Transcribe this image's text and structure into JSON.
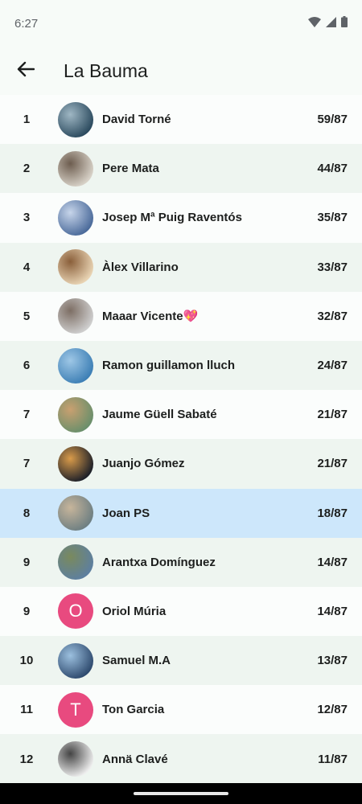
{
  "status": {
    "time": "6:27"
  },
  "header": {
    "title": "La Bauma"
  },
  "icons": {
    "back": "arrow-back-icon",
    "wifi": "wifi-icon",
    "signal": "signal-icon",
    "battery": "battery-icon"
  },
  "colors": {
    "highlight": "#cde7fb",
    "letter_avatar": "#e84a7f"
  },
  "rows": [
    {
      "rank": "1",
      "name": "David Torné",
      "score": "59/87",
      "avatar": "photo-avatar"
    },
    {
      "rank": "2",
      "name": "Pere Mata",
      "score": "44/87",
      "avatar": "photo-avatar"
    },
    {
      "rank": "3",
      "name": "Josep Mª Puig Raventós",
      "score": "35/87",
      "avatar": "photo-avatar"
    },
    {
      "rank": "4",
      "name": "Àlex Villarino",
      "score": "33/87",
      "avatar": "photo-avatar"
    },
    {
      "rank": "5",
      "name": "Maaar Vicente💖",
      "score": "32/87",
      "avatar": "photo-avatar"
    },
    {
      "rank": "6",
      "name": "Ramon guillamon lluch",
      "score": "24/87",
      "avatar": "photo-avatar"
    },
    {
      "rank": "7",
      "name": "Jaume Güell Sabaté",
      "score": "21/87",
      "avatar": "photo-avatar"
    },
    {
      "rank": "7",
      "name": "Juanjo Gómez",
      "score": "21/87",
      "avatar": "photo-avatar"
    },
    {
      "rank": "8",
      "name": "Joan PS",
      "score": "18/87",
      "avatar": "photo-avatar",
      "highlighted": true
    },
    {
      "rank": "9",
      "name": "Arantxa Domínguez",
      "score": "14/87",
      "avatar": "photo-avatar"
    },
    {
      "rank": "9",
      "name": "Oriol Múria",
      "score": "14/87",
      "avatar_letter": "O"
    },
    {
      "rank": "10",
      "name": "Samuel M.A",
      "score": "13/87",
      "avatar": "photo-avatar"
    },
    {
      "rank": "11",
      "name": "Ton Garcia",
      "score": "12/87",
      "avatar_letter": "T"
    },
    {
      "rank": "12",
      "name": "Annä Clavé",
      "score": "11/87",
      "avatar": "photo-avatar"
    }
  ]
}
